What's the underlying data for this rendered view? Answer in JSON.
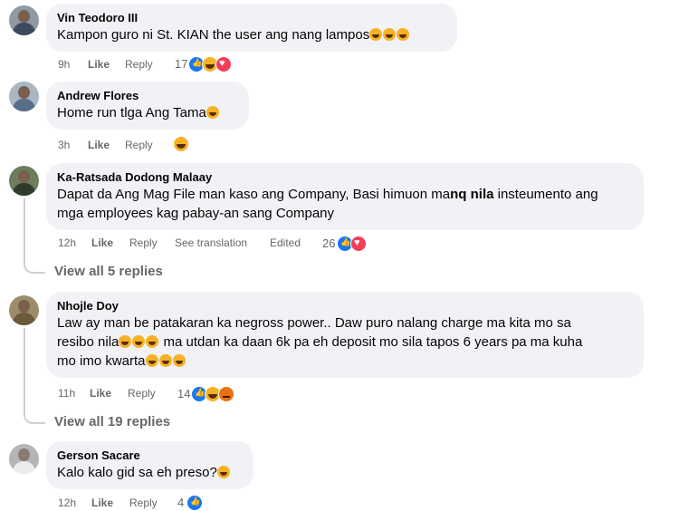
{
  "comments": [
    {
      "name": "Vin Teodoro III",
      "text": "Kampon guro ni St. KIAN the user ang nang lampos",
      "time": "9h",
      "like": "Like",
      "reply": "Reply",
      "count": "17"
    },
    {
      "name": "Andrew Flores",
      "text": "Home run tlga Ang Tama",
      "time": "3h",
      "like": "Like",
      "reply": "Reply"
    },
    {
      "name": "Ka-Ratsada Dodong Malaay",
      "text1": "Dapat da Ang Mag File man kaso ang Company, Basi himuon ma",
      "text1b": "nq nila",
      "text1c": " insteumento ang",
      "text2": "mga employees kag pabay-an sang Company",
      "time": "12h",
      "like": "Like",
      "reply": "Reply",
      "translate": "See translation",
      "edited": "Edited",
      "count": "26",
      "view": "View all 5 replies"
    },
    {
      "name": "Nhojle Doy",
      "text1": "Law ay man be patakaran ka negross power.. Daw puro nalang charge ma kita mo sa",
      "text2a": "resibo nila",
      "text2b": " ma utdan ka daan 6k pa eh deposit mo sila tapos 6 years pa ma kuha",
      "text3": "mo imo kwarta",
      "time": "11h",
      "like": "Like",
      "reply": "Reply",
      "count": "14",
      "view": "View all 19 replies"
    },
    {
      "name": "Gerson Sacare",
      "text": "Kalo kalo gid sa eh preso?",
      "time": "12h",
      "like": "Like",
      "reply": "Reply",
      "count": "4"
    }
  ],
  "colors": {
    "like": "#1877f2",
    "haha": "#f7b125",
    "love": "#f33e58",
    "angry": "#e9710f"
  }
}
